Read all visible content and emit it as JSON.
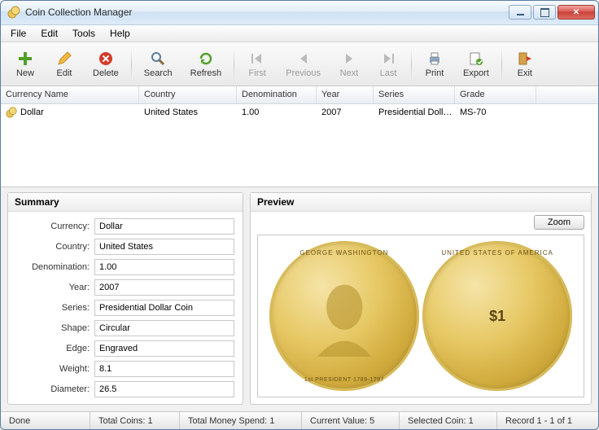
{
  "window": {
    "title": "Coin Collection Manager"
  },
  "menu": {
    "file": "File",
    "edit": "Edit",
    "tools": "Tools",
    "help": "Help"
  },
  "toolbar": {
    "new": "New",
    "edit": "Edit",
    "delete": "Delete",
    "search": "Search",
    "refresh": "Refresh",
    "first": "First",
    "previous": "Previous",
    "next": "Next",
    "last": "Last",
    "print": "Print",
    "export": "Export",
    "exit": "Exit"
  },
  "grid": {
    "headers": {
      "currency_name": "Currency Name",
      "country": "Country",
      "denomination": "Denomination",
      "year": "Year",
      "series": "Series",
      "grade": "Grade"
    },
    "rows": [
      {
        "currency_name": "Dollar",
        "country": "United States",
        "denomination": "1.00",
        "year": "2007",
        "series": "Presidential Doll…",
        "grade": "MS-70"
      }
    ]
  },
  "summary": {
    "title": "Summary",
    "labels": {
      "currency": "Currency:",
      "country": "Country:",
      "denomination": "Denomination:",
      "year": "Year:",
      "series": "Series:",
      "shape": "Shape:",
      "edge": "Edge:",
      "weight": "Weight:",
      "diameter": "Diameter:"
    },
    "values": {
      "currency": "Dollar",
      "country": "United States",
      "denomination": "1.00",
      "year": "2007",
      "series": "Presidential Dollar Coin",
      "shape": "Circular",
      "edge": "Engraved",
      "weight": "8.1",
      "diameter": "26.5"
    }
  },
  "preview": {
    "title": "Preview",
    "zoom": "Zoom",
    "obverse": {
      "top": "GEORGE WASHINGTON",
      "bottom": "1st PRESIDENT 1789-1797"
    },
    "reverse": {
      "top": "UNITED STATES OF AMERICA",
      "center": "$1"
    }
  },
  "status": {
    "done": "Done",
    "total_coins": "Total Coins: 1",
    "total_money": "Total Money Spend: 1",
    "current_value": "Current Value: 5",
    "selected_coin": "Selected Coin: 1",
    "record": "Record 1 - 1 of 1"
  }
}
